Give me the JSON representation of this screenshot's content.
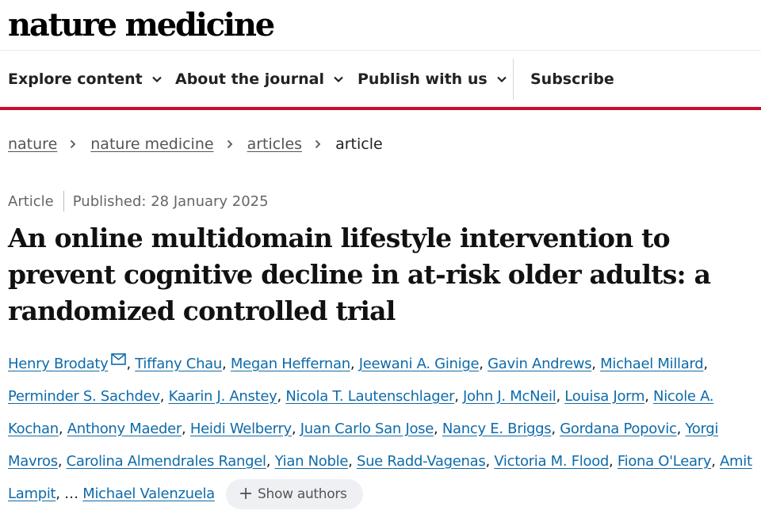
{
  "logo": "nature medicine",
  "nav": {
    "explore": "Explore content",
    "about": "About the journal",
    "publish": "Publish with us",
    "subscribe": "Subscribe"
  },
  "breadcrumb": {
    "items": [
      "nature",
      "nature medicine",
      "articles"
    ],
    "current": "article"
  },
  "article": {
    "type": "Article",
    "published": "Published: 28 January 2025",
    "title": "An online multidomain lifestyle intervention to prevent cognitive decline in at-risk older adults: a randomized controlled trial",
    "authors": [
      "Henry Brodaty",
      "Tiffany Chau",
      "Megan Heffernan",
      "Jeewani A. Ginige",
      "Gavin Andrews",
      "Michael Millard",
      "Perminder S. Sachdev",
      "Kaarin J. Anstey",
      "Nicola T. Lautenschlager",
      "John J. McNeil",
      "Louisa Jorm",
      "Nicole A. Kochan",
      "Anthony Maeder",
      "Heidi Welberry",
      "Juan Carlo San Jose",
      "Nancy E. Briggs",
      "Gordana Popovic",
      "Yorgi Mavros",
      "Carolina Almendrales Rangel",
      "Yian Noble",
      "Sue Radd-Vagenas",
      "Victoria M. Flood",
      "Fiona O'Leary",
      "Amit Lampit"
    ],
    "ellipsis": "…",
    "last_author": "Michael Valenzuela",
    "show_authors": "Show authors",
    "icons": {
      "corresponding": "mail-icon",
      "show_authors": "plus-icon"
    }
  },
  "colors": {
    "accent": "#c8102e",
    "link": "#0f6ba8"
  }
}
